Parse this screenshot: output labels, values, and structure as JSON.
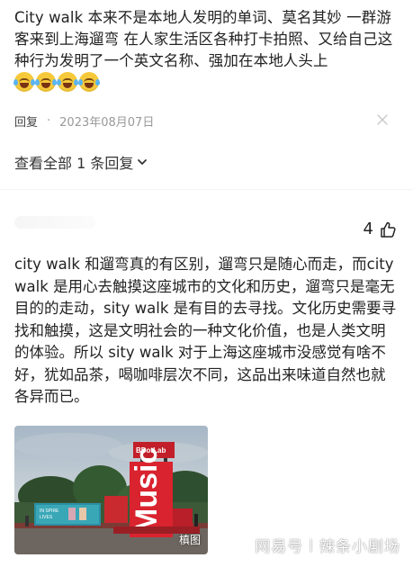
{
  "comment1": {
    "text": "City walk 本来不是本地人发明的单词、莫名其妙 一群游客来到上海遛弯 在人家生活区各种打卡拍照、又给自己这种行为发明了一个英文名称、强加在本地人头上",
    "emojis": [
      "laughing-tears-emoji",
      "laughing-tears-emoji",
      "laughing-tears-emoji",
      "laughing-tears-emoji"
    ]
  },
  "meta": {
    "reply_label": "回复",
    "separator": "·",
    "date": "2023年08月07日",
    "close_icon": "close-icon"
  },
  "replies": {
    "view_all_label": "查看全部 1 条回复",
    "chevron_icon": "chevron-down-icon"
  },
  "comment2": {
    "likes": "4",
    "like_icon": "thumbs-up-icon",
    "text": "city walk 和遛弯真的有区别，遛弯只是随心而走，而city walk 是用心去触摸这座城市的文化和历史，遛弯只是毫无目的的走动，sity walk 是有目的去寻找。文化历史需要寻找和触摸，这是文明社会的一种文化价值，也是人类文明的体验。所以 sity walk 对于上海这座城市没感觉有啥不好，犹如品茶，喝咖啡层次不同，这品出来味道自然也就各异而已。",
    "image_tag": "槙图"
  },
  "watermark": {
    "source": "网易号",
    "separator": "|",
    "author": "辣条小剧场"
  },
  "colors": {
    "text": "#222222",
    "muted": "#999999",
    "emoji_yellow": "#f6c93a",
    "photo_red": "#d9232e"
  }
}
